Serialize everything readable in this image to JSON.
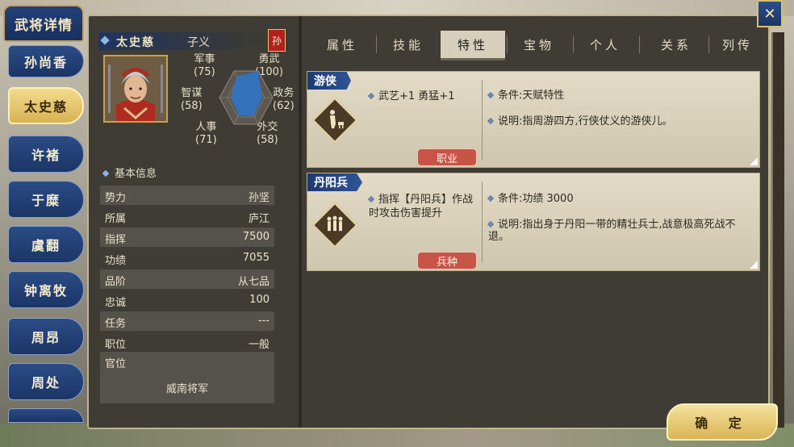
{
  "window_title": "武将详情",
  "sidebar": {
    "items": [
      {
        "label": "孙尚香",
        "active": false
      },
      {
        "label": "太史慈",
        "active": true
      },
      {
        "label": "许褚",
        "active": false
      },
      {
        "label": "于糜",
        "active": false
      },
      {
        "label": "虞翻",
        "active": false
      },
      {
        "label": "钟离牧",
        "active": false
      },
      {
        "label": "周昂",
        "active": false
      },
      {
        "label": "周处",
        "active": false
      }
    ]
  },
  "general": {
    "name": "太史慈",
    "courtesy": "子义",
    "faction_seal": "孙",
    "stats": {
      "military": {
        "label": "军事",
        "value": "(75)"
      },
      "valor": {
        "label": "勇武",
        "value": "(100)"
      },
      "strategy": {
        "label": "智谋",
        "value": "(58)"
      },
      "politics": {
        "label": "政务",
        "value": "(62)"
      },
      "personnel": {
        "label": "人事",
        "value": "(71)"
      },
      "diplomacy": {
        "label": "外交",
        "value": "(58)"
      }
    }
  },
  "basic_info": {
    "heading": "基本信息",
    "rows": [
      {
        "key": "势力",
        "value": "孙坚"
      },
      {
        "key": "所属",
        "value": "庐江"
      },
      {
        "key": "指挥",
        "value": "7500"
      },
      {
        "key": "功绩",
        "value": "7055"
      },
      {
        "key": "品阶",
        "value": "从七品"
      },
      {
        "key": "忠诚",
        "value": "100"
      },
      {
        "key": "任务",
        "value": "---"
      },
      {
        "key": "职位",
        "value": "一般"
      },
      {
        "key": "官位",
        "value": ""
      }
    ],
    "office_title": "威南将军"
  },
  "tabs": [
    "属性",
    "技能",
    "特性",
    "宝物",
    "个人",
    "关系",
    "列传"
  ],
  "active_tab": "特性",
  "traits": [
    {
      "name": "游侠",
      "effect": "武艺+1 勇猛+1",
      "condition": "条件:天赋特性",
      "description": "说明:指周游四方,行侠仗义的游侠儿。",
      "badge": "职业"
    },
    {
      "name": "丹阳兵",
      "effect": "指挥【丹阳兵】作战时攻击伤害提升",
      "condition": "条件:功绩 3000",
      "description": "说明:指出身于丹阳一带的精壮兵士,战意极高死战不退。",
      "badge": "兵种"
    }
  ],
  "confirm_label": "确 定",
  "colors": {
    "accent_blue": "#1d3a6e",
    "gold": "#d9b456",
    "badge_red": "#c65447"
  }
}
